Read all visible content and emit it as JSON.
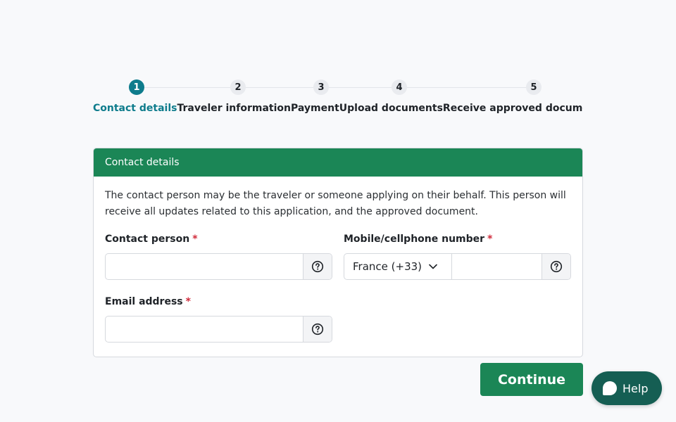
{
  "stepper": {
    "steps": [
      {
        "number": "1",
        "label": "Contact details"
      },
      {
        "number": "2",
        "label": "Traveler information"
      },
      {
        "number": "3",
        "label": "Payment"
      },
      {
        "number": "4",
        "label": "Upload documents"
      },
      {
        "number": "5",
        "label": "Receive approved document"
      }
    ],
    "active_step": 1
  },
  "card": {
    "title": "Contact details",
    "intro": "The contact person may be the traveler or someone applying on their behalf. This person will receive all updates related to this application, and the approved document.",
    "contact_person": {
      "label": "Contact person",
      "required_mark": "*",
      "value": ""
    },
    "mobile": {
      "label": "Mobile/cellphone number",
      "required_mark": "*",
      "country": "France (+33)",
      "value": ""
    },
    "email": {
      "label": "Email address",
      "required_mark": "*",
      "value": ""
    }
  },
  "actions": {
    "continue_label": "Continue"
  },
  "help_widget": {
    "label": "Help"
  },
  "icons": {
    "field_help": "question-circle-icon",
    "dropdown": "chevron-down-icon",
    "chat": "chat-bubble-icon"
  },
  "colors": {
    "accent_teal": "#0e7c8c",
    "primary_green": "#1b8656",
    "help_widget": "#155e53",
    "required": "#d02a3a"
  }
}
